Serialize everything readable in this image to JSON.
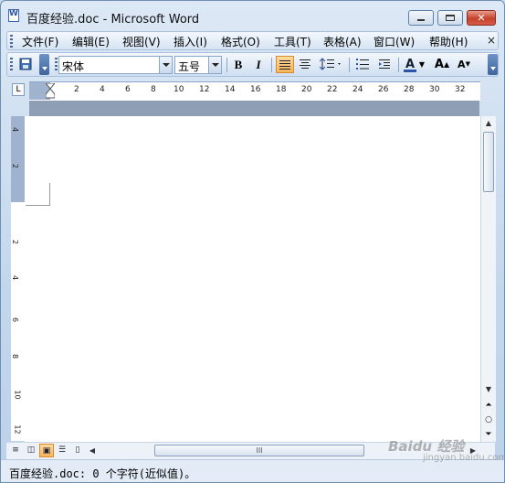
{
  "window": {
    "title": "百度经验.doc - Microsoft Word"
  },
  "menu": {
    "items": [
      "文件(F)",
      "编辑(E)",
      "视图(V)",
      "插入(I)",
      "格式(O)",
      "工具(T)",
      "表格(A)",
      "窗口(W)",
      "帮助(H)"
    ],
    "close_glyph": "×"
  },
  "toolbar": {
    "font_name": "宋体",
    "font_size": "五号",
    "bold": "B",
    "italic": "I",
    "font_color_letter": "A",
    "grow_font": "A",
    "shrink_font": "A"
  },
  "ruler": {
    "h_ticks": [
      "2",
      "4",
      "6",
      "8",
      "10",
      "12",
      "14",
      "16",
      "18",
      "20",
      "22",
      "24",
      "26",
      "28",
      "30",
      "32"
    ],
    "v_ticks": [
      "4",
      "2",
      "2",
      "4",
      "6",
      "8",
      "10",
      "12"
    ],
    "tab_selector": "L"
  },
  "scrollbar": {
    "h_thumb_grip": "III"
  },
  "status": {
    "text": "百度经验.doc: 0 个字符(近似值)。"
  },
  "watermark": {
    "brand": "Baidu 经验",
    "sub": "jingyan.baidu.com"
  },
  "colors": {
    "accent_active": "#f6b45b",
    "close_button": "#c6422c",
    "frame": "#c3d7ec"
  }
}
